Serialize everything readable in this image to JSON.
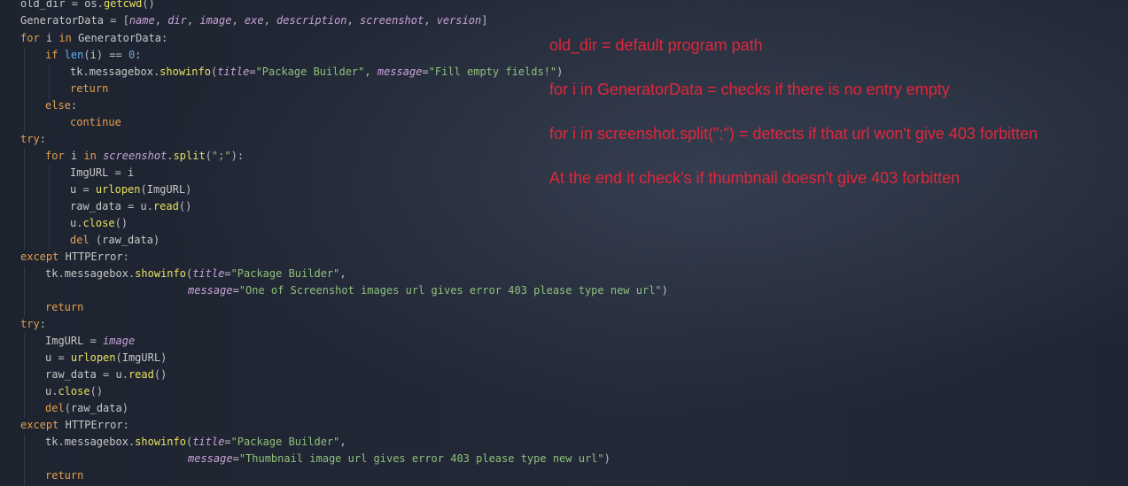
{
  "code": {
    "lines": [
      "old_dir = os.getcwd()",
      "GeneratorData = [name, dir, image, exe, description, screenshot, version]",
      "for i in GeneratorData:",
      "if len(i) == 0:",
      "tk.messagebox.showinfo(title=\"Package Builder\", message=\"Fill empty fields!\")",
      "return",
      "else:",
      "continue",
      "try:",
      "for i in screenshot.split(\";\"):",
      "ImgURL = i",
      "u = urlopen(ImgURL)",
      "raw_data = u.read()",
      "u.close()",
      "del (raw_data)",
      "except HTTPError:",
      "tk.messagebox.showinfo(title=\"Package Builder\",",
      "message=\"One of Screenshot images url gives error 403 please type new url\")",
      "return",
      "try:",
      "ImgURL = image",
      "u = urlopen(ImgURL)",
      "raw_data = u.read()",
      "u.close()",
      "del(raw_data)",
      "except HTTPError:",
      "tk.messagebox.showinfo(title=\"Package Builder\",",
      "message=\"Thumbnail image url gives error 403 please type new url\")",
      "return"
    ]
  },
  "annotations": [
    "old_dir = default program path",
    "for i in GeneratorData = checks if there is no entry empty",
    "for i in screenshot.split(\";\") = detects if that url won't give 403 forbitten",
    "At the end it check's if thumbnail doesn't give 403 forbitten"
  ],
  "colors": {
    "background": "#1f2430",
    "annotation": "#e2263a",
    "keyword": "#e2a04f",
    "string": "#8ec07c",
    "call": "#61b1ef"
  }
}
